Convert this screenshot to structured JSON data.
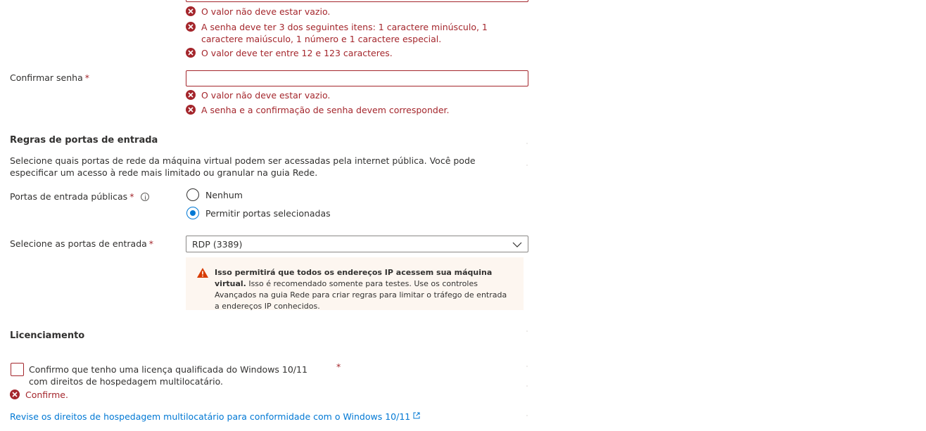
{
  "password": {
    "errors": [
      "O valor não deve estar vazio.",
      "A senha deve ter 3 dos seguintes itens: 1 caractere minúsculo, 1 caractere maiúsculo, 1 número e 1 caractere especial.",
      "O valor deve ter entre 12 e 123 caracteres."
    ]
  },
  "confirm_password": {
    "label": "Confirmar senha",
    "required_mark": "*",
    "value": "",
    "errors": [
      "O valor não deve estar vazio.",
      "A senha e a confirmação de senha devem corresponder."
    ]
  },
  "inbound": {
    "heading": "Regras de portas de entrada",
    "description": "Selecione quais portas de rede da máquina virtual podem ser acessadas pela internet pública. Você pode especificar um acesso à rede mais limitado ou granular na guia Rede.",
    "public_ports_label": "Portas de entrada públicas",
    "required_mark": "*",
    "options": [
      "Nenhum",
      "Permitir portas selecionadas"
    ],
    "selected_option": "Permitir portas selecionadas",
    "select_ports_label": "Selecione as portas de entrada",
    "select_ports_value": "RDP (3389)",
    "warning_bold": "Isso permitirá que todos os endereços IP acessem sua máquina virtual.",
    "warning_text": "Isso é recomendado somente para testes.  Use os controles Avançados na guia Rede para criar regras para limitar o tráfego de entrada a endereços IP conhecidos."
  },
  "licensing": {
    "heading": "Licenciamento",
    "checkbox_label": "Confirmo que tenho uma licença qualificada do Windows 10/11 com direitos de hospedagem multilocatário.",
    "required_mark": "*",
    "error": "Confirme.",
    "link_text": "Revise os direitos de hospedagem multilocatário para conformidade com o Windows 10/11"
  },
  "colors": {
    "error": "#a4262c",
    "accent": "#0078d4",
    "warning_bg": "#fdf6f0",
    "warning_icon": "#d83b01"
  },
  "icons": {
    "error": "error-circle-icon",
    "info": "info-icon",
    "warning": "warning-triangle-icon",
    "chevron": "chevron-down-icon",
    "external": "external-link-icon"
  }
}
